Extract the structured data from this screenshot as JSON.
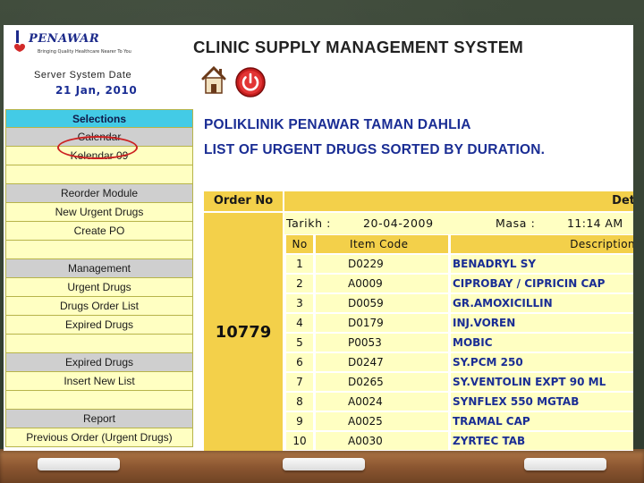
{
  "header": {
    "logo_text": "PENAWAR",
    "logo_tagline": "Bringing Quality Healthcare Nearer To You",
    "server_date_label": "Server System Date",
    "server_date": "21 Jan, 2010",
    "system_title": "CLINIC SUPPLY MANAGEMENT SYSTEM",
    "home_icon": "home-icon",
    "power_icon": "power-icon"
  },
  "sidebar": {
    "selections_label": "Selections",
    "calendar_section": "Calendar",
    "calendar_item": "Kelendar 09",
    "reorder_section": "Reorder Module",
    "new_urgent_drugs": "New Urgent Drugs",
    "create_po": "Create PO",
    "management_section": "Management",
    "urgent_drugs": "Urgent Drugs",
    "drugs_order_list": "Drugs Order List",
    "expired_drugs_1": "Expired Drugs",
    "expired_section": "Expired Drugs",
    "insert_new_list": "Insert New List",
    "report_section": "Report",
    "previous_order": "Previous Order (Urgent Drugs)"
  },
  "main": {
    "clinic_name": "POLIKLINIK PENAWAR TAMAN DAHLIA",
    "list_title": "LIST OF URGENT DRUGS SORTED BY DURATION.",
    "order_no_header": "Order No",
    "details_header": "Det",
    "order_no": "10779",
    "tarikh_label": "Tarikh :",
    "tarikh_value": "20-04-2009",
    "masa_label": "Masa :",
    "masa_value": "11:14 AM",
    "columns": [
      "No",
      "Item Code",
      "Description"
    ],
    "items": [
      {
        "no": "1",
        "code": "D0229",
        "desc": "BENADRYL SY"
      },
      {
        "no": "2",
        "code": "A0009",
        "desc": "CIPROBAY / CIPRICIN CAP"
      },
      {
        "no": "3",
        "code": "D0059",
        "desc": "GR.AMOXICILLIN"
      },
      {
        "no": "4",
        "code": "D0179",
        "desc": "INJ.VOREN"
      },
      {
        "no": "5",
        "code": "P0053",
        "desc": "MOBIC"
      },
      {
        "no": "6",
        "code": "D0247",
        "desc": "SY.PCM 250"
      },
      {
        "no": "7",
        "code": "D0265",
        "desc": "SY.VENTOLIN EXPT 90 ML"
      },
      {
        "no": "8",
        "code": "A0024",
        "desc": "SYNFLEX 550 MGTAB"
      },
      {
        "no": "9",
        "code": "A0025",
        "desc": "TRAMAL CAP"
      },
      {
        "no": "10",
        "code": "A0030",
        "desc": "ZYRTEC TAB"
      }
    ]
  },
  "colors": {
    "accent_blue": "#1a2d94",
    "selections_bg": "#43cbe6",
    "cell_yellow": "#ffffc2",
    "header_gold": "#f3d04a",
    "highlight_red": "#cc2222"
  }
}
